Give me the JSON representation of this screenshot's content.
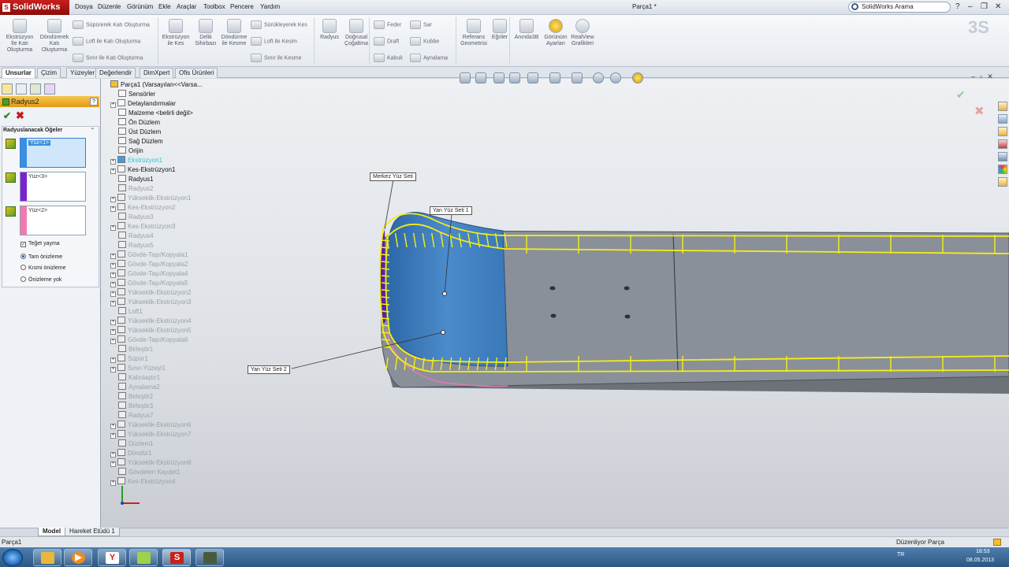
{
  "app": {
    "brand": "SolidWorks",
    "doc_title": "Parça1 *",
    "search_placeholder": "SolidWorks Arama"
  },
  "menu": [
    "Dosya",
    "Düzenle",
    "Görünüm",
    "Ekle",
    "Araçlar",
    "Toolbox",
    "Pencere",
    "Yardım"
  ],
  "ribbon": {
    "left_big": [
      {
        "label1": "Ekstrüzyon",
        "label2": "İle Katı",
        "label3": "Oluşturma"
      },
      {
        "label1": "Döndürerek",
        "label2": "Katı",
        "label3": "Oluşturma"
      },
      {
        "label1": "Ekstrüzyon",
        "label2": "ile Kes",
        "label3": ""
      },
      {
        "label1": "Delik",
        "label2": "Sihirbazı",
        "label3": ""
      },
      {
        "label1": "Döndürme",
        "label2": "ile Kesme",
        "label3": ""
      },
      {
        "label1": "Radyus",
        "label2": "",
        "label3": ""
      },
      {
        "label1": "Doğrusal",
        "label2": "Çoğaltma",
        "label3": ""
      },
      {
        "label1": "Referans",
        "label2": "Geometrisi",
        "label3": ""
      },
      {
        "label1": "Eğriler",
        "label2": "",
        "label3": ""
      },
      {
        "label1": "Anında3B",
        "label2": "",
        "label3": ""
      },
      {
        "label1": "Görünüm",
        "label2": "Ayarları",
        "label3": ""
      },
      {
        "label1": "RealView",
        "label2": "Grafikleri",
        "label3": ""
      }
    ],
    "small": [
      "Süpürerek Katı Oluşturma",
      "Loft ile Katı Oluşturma",
      "Sınır ile Katı Oluşturma",
      "Sürükleyerek Kes",
      "Loft ile Kesim",
      "Sınır ile Kesme",
      "Feder",
      "Draft",
      "Kabuk",
      "Sar",
      "Kubbe",
      "Aynalama"
    ]
  },
  "tabs": [
    "Unsurlar",
    "Çizim",
    "Yüzeyler",
    "Değerlendir",
    "DimXpert",
    "Ofis Ürünleri"
  ],
  "feature": {
    "title": "Radyus2",
    "group_title": "Radyuslanacak Öğeler",
    "faces": [
      {
        "label": "Yüz<1>",
        "color": "#3a8fe0"
      },
      {
        "label": "Yüz<3>",
        "color": "#7a22cc"
      },
      {
        "label": "Yüz<2>",
        "color": "#f07ab0"
      }
    ],
    "tangent": "Teğet yayma",
    "previews": [
      "Tam önizleme",
      "Kısmi önizleme",
      "Önizleme yok"
    ]
  },
  "tree": [
    {
      "label": "Parça1  (Varsayılan<<Varsa...",
      "state": "root"
    },
    {
      "label": "Sensörler",
      "state": "normal"
    },
    {
      "label": "Detaylandırmalar",
      "state": "normal",
      "exp": true
    },
    {
      "label": "Malzeme <belirli değil>",
      "state": "normal"
    },
    {
      "label": "Ön Düzlem",
      "state": "normal"
    },
    {
      "label": "Üst Düzlem",
      "state": "normal"
    },
    {
      "label": "Sağ Düzlem",
      "state": "normal"
    },
    {
      "label": "Orijin",
      "state": "normal"
    },
    {
      "label": "Ekstrüzyon1",
      "state": "hl",
      "exp": true
    },
    {
      "label": "Kes-Ekstrüzyon1",
      "state": "normal",
      "exp": true
    },
    {
      "label": "Radyus1",
      "state": "normal"
    },
    {
      "label": "Radyus2",
      "state": "grey"
    },
    {
      "label": "Yükseklik-Ekstrüzyon1",
      "state": "grey",
      "exp": true
    },
    {
      "label": "Kes-Ekstrüzyon2",
      "state": "grey",
      "exp": true
    },
    {
      "label": "Radyus3",
      "state": "grey"
    },
    {
      "label": "Kes-Ekstrüzyon3",
      "state": "grey",
      "exp": true
    },
    {
      "label": "Radyus4",
      "state": "grey"
    },
    {
      "label": "Radyus5",
      "state": "grey"
    },
    {
      "label": "Gövde-Taşı/Kopyala1",
      "state": "grey",
      "exp": true
    },
    {
      "label": "Gövde-Taşı/Kopyala2",
      "state": "grey",
      "exp": true
    },
    {
      "label": "Gövde-Taşı/Kopyala4",
      "state": "grey",
      "exp": true
    },
    {
      "label": "Gövde-Taşı/Kopyala5",
      "state": "grey",
      "exp": true
    },
    {
      "label": "Yükseklik-Ekstrüzyon2",
      "state": "grey",
      "exp": true
    },
    {
      "label": "Yükseklik-Ekstrüzyon3",
      "state": "grey",
      "exp": true
    },
    {
      "label": "Loft1",
      "state": "grey"
    },
    {
      "label": "Yükseklik-Ekstrüzyon4",
      "state": "grey",
      "exp": true
    },
    {
      "label": "Yükseklik-Ekstrüzyon5",
      "state": "grey",
      "exp": true
    },
    {
      "label": "Gövde-Taşı/Kopyala6",
      "state": "grey",
      "exp": true
    },
    {
      "label": "Birleştir1",
      "state": "grey"
    },
    {
      "label": "Süpür1",
      "state": "grey",
      "exp": true
    },
    {
      "label": "Sınır-Yüzeyi1",
      "state": "grey",
      "exp": true
    },
    {
      "label": "Kalınlaştır1",
      "state": "grey"
    },
    {
      "label": "Aynalama2",
      "state": "grey"
    },
    {
      "label": "Birleştir2",
      "state": "grey"
    },
    {
      "label": "Birleştir3",
      "state": "grey"
    },
    {
      "label": "Radyus7",
      "state": "grey"
    },
    {
      "label": "Yükseklik-Ekstrüzyon6",
      "state": "grey",
      "exp": true
    },
    {
      "label": "Yükseklik-Ekstrüzyon7",
      "state": "grey",
      "exp": true
    },
    {
      "label": "Düzlem1",
      "state": "grey"
    },
    {
      "label": "Döndür1",
      "state": "grey",
      "exp": true
    },
    {
      "label": "Yükseklik-Ekstrüzyon8",
      "state": "grey",
      "exp": true
    },
    {
      "label": "Gövdeleri Kaydet1",
      "state": "grey"
    },
    {
      "label": "Kes-Ekstrüzyon4",
      "state": "grey",
      "exp": true
    }
  ],
  "callouts": {
    "merkez": "Merkez Yüz Seti",
    "yan1": "Yan Yüz Seti 1",
    "yan2": "Yan Yüz Seti 2"
  },
  "bottom_tabs": [
    "Model",
    "Hareket Etüdü 1"
  ],
  "status": {
    "left": "Parça1",
    "right": "Düzenliyor Parça"
  },
  "tray": {
    "lang": "TR",
    "time": "18:53",
    "date": "08.05.2013"
  }
}
